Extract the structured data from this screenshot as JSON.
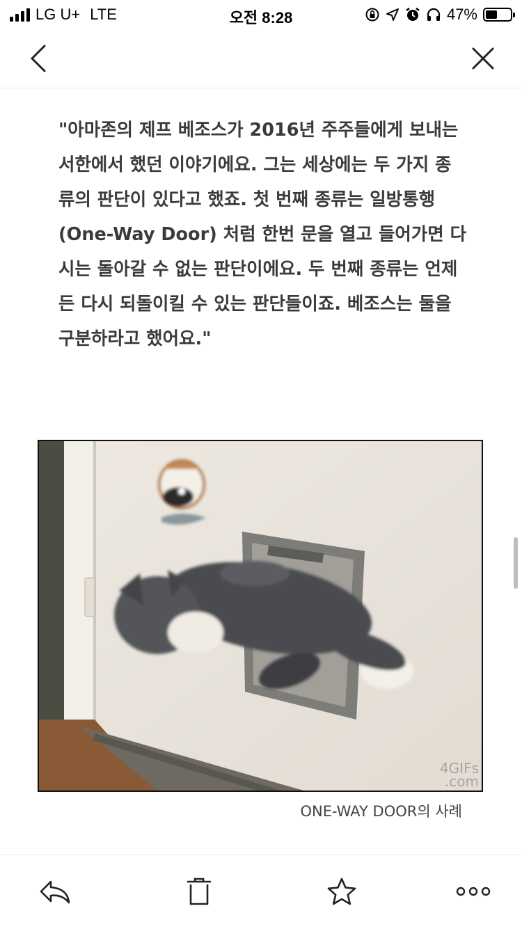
{
  "status_bar": {
    "carrier": "LG U+",
    "network": "LTE",
    "time": "오전 8:28",
    "battery_percent": "47%",
    "battery_level": 0.47,
    "icons": [
      "lock-rotation-icon",
      "location-icon",
      "alarm-icon",
      "headphones-icon",
      "battery-icon"
    ]
  },
  "nav": {
    "back_icon": "chevron-left-icon",
    "close_icon": "close-icon"
  },
  "article": {
    "quote": "\"아마존의 제프 베조스가 2016년 주주들에게 보내는\n서한에서 했던 이야기에요. 그는 세상에는 두 가지 종\n류의 판단이 있다고 했죠. 첫 번째 종류는 일방통행\n(One-Way Door) 처럼 한번 문을 열고 들어가면 다\n시는 돌아갈 수 없는 판단이에요. 두 번째 종류는 언제\n든 다시 되돌이킬 수 있는 판단들이죠. 베조스는 둘을\n구분하라고 했어요.\"",
    "image_watermark_line1": "4GIFs",
    "image_watermark_line2": ".com",
    "caption": "ONE-WAY DOOR의 사례"
  },
  "toolbar": {
    "reply_icon": "reply-icon",
    "delete_icon": "trash-icon",
    "favorite_icon": "star-icon",
    "more_icon": "more-icon"
  },
  "colors": {
    "text": "#3a3a3a",
    "caption": "#444444",
    "divider": "#ececec"
  }
}
